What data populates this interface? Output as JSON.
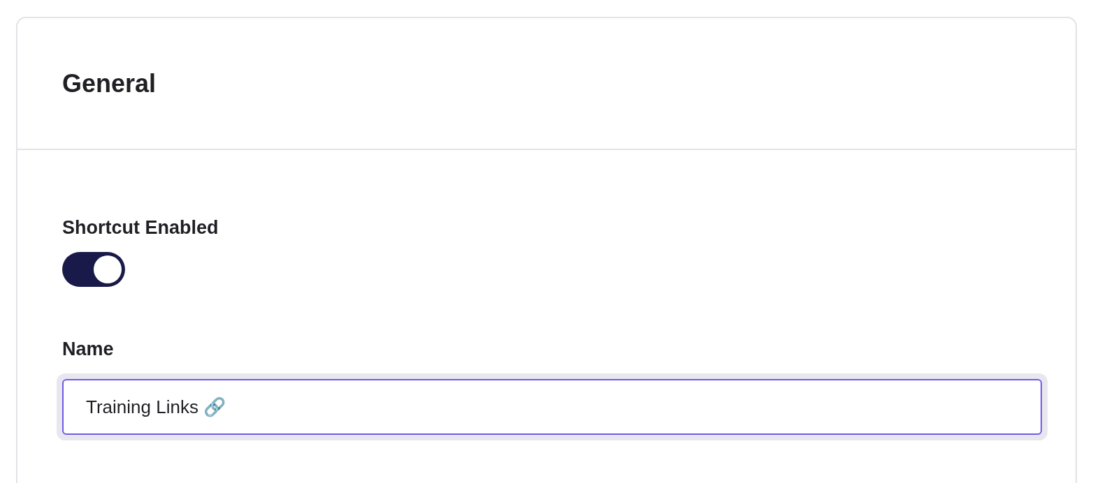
{
  "section": {
    "title": "General"
  },
  "fields": [
    {
      "kind": "toggle",
      "label": "Shortcut Enabled",
      "on": true
    },
    {
      "kind": "text",
      "label": "Name",
      "value": "Training Links 🔗",
      "focused": true
    }
  ]
}
